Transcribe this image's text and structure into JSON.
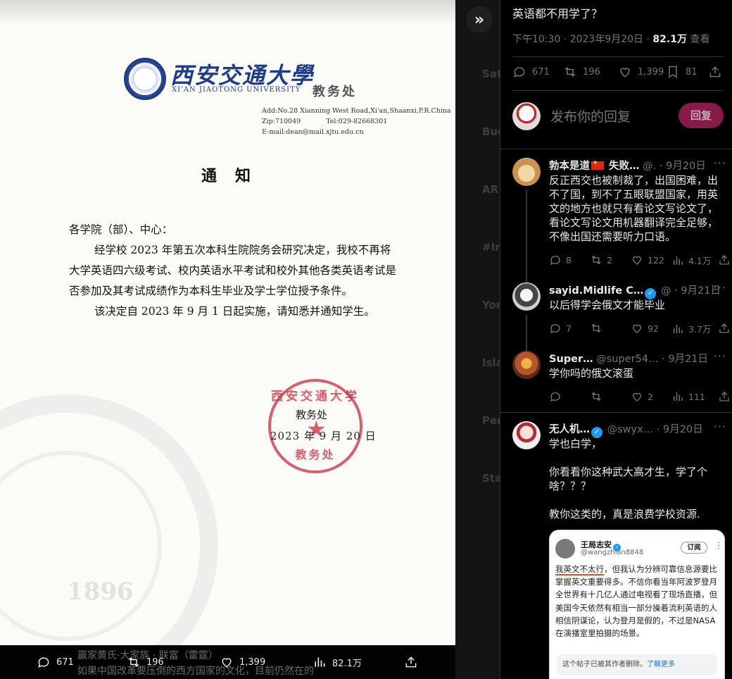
{
  "viewer": {
    "document": {
      "university_name": "西安交通大學",
      "university_en": "XI'AN JIAOTONG UNIVERSITY",
      "office_header": "教务处",
      "address": "Add:No.28 Xianning West Road,Xi'an,Shaanxi,P.R.China",
      "zip": "Zip:710049",
      "tel": "Tel:029-82668301",
      "email": "E-mail:dean@mail.xjtu.edu.cn",
      "title": "通知",
      "salutation": "各学院（部）、中心：",
      "paragraph_1": "经学校 2023 年第五次本科生院院务会研究决定，我校不再将大学英语四六级考试、校内英语水平考试和校外其他各类英语考试是否参加及其考试成绩作为本科生毕业及学士学位授予条件。",
      "paragraph_2": "该决定自 2023 年 9 月 1 日起实施，请知悉并通知学生。",
      "stamp_ring": "西安交通大学",
      "stamp_bottom": "教务处",
      "sign_office": "教务处",
      "sign_date": "2023 年 9 月 20 日",
      "watermark_year": "1896"
    },
    "underlay_line1": "赢家黄氏·大家族 · 联富（雷霆）",
    "underlay_line2": "如果中国改革要压倒的西方国家的文化，目前仍然在的",
    "actions": {
      "replies": "671",
      "reposts": "196",
      "likes": "1,399",
      "views": "82.1万"
    }
  },
  "tweet": {
    "text": "英语都不用学了？",
    "time": "下午10:30 · 2023年9月20日 · ",
    "views": "82.1万",
    "views_label": " 查看",
    "stats": {
      "replies": "671",
      "reposts": "196",
      "likes": "1,399",
      "bookmarks": "81"
    }
  },
  "reply_composer": {
    "placeholder": "发布你的回复",
    "button": "回复"
  },
  "replies": [
    {
      "name": "勃本是道",
      "name_suffix": " 失败…",
      "handle": " @.",
      "date": " · 9月20日",
      "body": [
        "反正西交也被制裁了，出国困难，出不了国，到不了五眼联盟国家，用英文的地方也就只有看论文写论文了，看论文写论文用机器翻译完全足够，不像出国还需要听力口语。"
      ],
      "replies": "8",
      "reposts": "2",
      "likes": "122",
      "views": "4.1万"
    },
    {
      "name": "sayid.Midlife C…",
      "handle": " @",
      "date": " · 9月21日",
      "body": [
        "以后得学会俄文才能毕业"
      ],
      "replies": "7",
      "reposts": "",
      "likes": "92",
      "views": "3.7万"
    },
    {
      "name": "Super…",
      "handle": "  @super54…",
      "date": " · 9月21日",
      "body": [
        "学你吗的俄文滚蛋"
      ],
      "replies": "",
      "reposts": "",
      "likes": "2",
      "views": "111"
    },
    {
      "name": "无人机…",
      "handle": " @swyx…",
      "date": " · 9月20日",
      "body": [
        "学也白学，",
        "",
        "你看看你这种武大高才生，学了个啥？？？",
        "",
        "教你这类的，真是浪费学校资源."
      ]
    }
  ],
  "embed": {
    "name": "王局志安",
    "handle": "@wangzhian8848",
    "subscribe": "订阅",
    "text_hl": "我英文不太行",
    "text_rest": "，但我认为分辨可靠信息源要比掌握英文重要得多。不信你看当年阿波罗登月全世界有十几亿人通过电视看了现场直播，但美国今天依然有相当一部分操着流利英语的人相信阴谋论，认为登月是假的，不过是NASA在演播室里拍摄的场景。",
    "note": "这个帖子已被其作者删除。",
    "note_link": "了解更多"
  },
  "colors": {
    "accent_pink": "#871a47",
    "verified_blue": "#1d9bf0",
    "stamp_red": "#cd283c"
  }
}
